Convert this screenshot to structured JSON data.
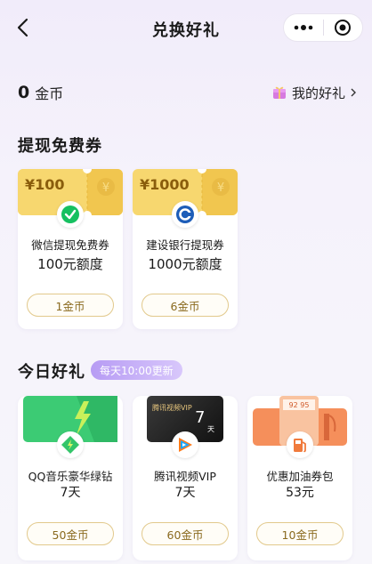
{
  "header": {
    "title": "兑换好礼"
  },
  "account": {
    "coin_value": "0",
    "coin_unit": "金币",
    "my_gifts_label": "我的好礼"
  },
  "voucher_section": {
    "title": "提现免费券",
    "items": [
      {
        "ticket_text": "¥100",
        "name": "微信提现免费券",
        "value": "100元额度",
        "price": "1金币"
      },
      {
        "ticket_text": "¥1000",
        "name": "建设银行提现券",
        "value": "1000元额度",
        "price": "6金币"
      }
    ]
  },
  "daily_section": {
    "title": "今日好礼",
    "badge": "每天10:00更新",
    "items": [
      {
        "name": "QQ音乐豪华绿钻",
        "value": "7天",
        "price": "50金币"
      },
      {
        "name": "腾讯视频VIP",
        "value": "7天",
        "price": "60金币",
        "image_text": "腾讯视频VIP",
        "image_days": "7",
        "image_day_unit": "天"
      },
      {
        "name": "优惠加油券包",
        "value": "53元",
        "price": "10金币",
        "image_text": "92 95"
      }
    ]
  },
  "colors": {
    "gold": "#f3cf63",
    "wechat_green": "#16c060",
    "ccb_blue": "#1d5db8",
    "qq_music_green": "#34c56a",
    "badge_purple": "#b79cf4"
  }
}
